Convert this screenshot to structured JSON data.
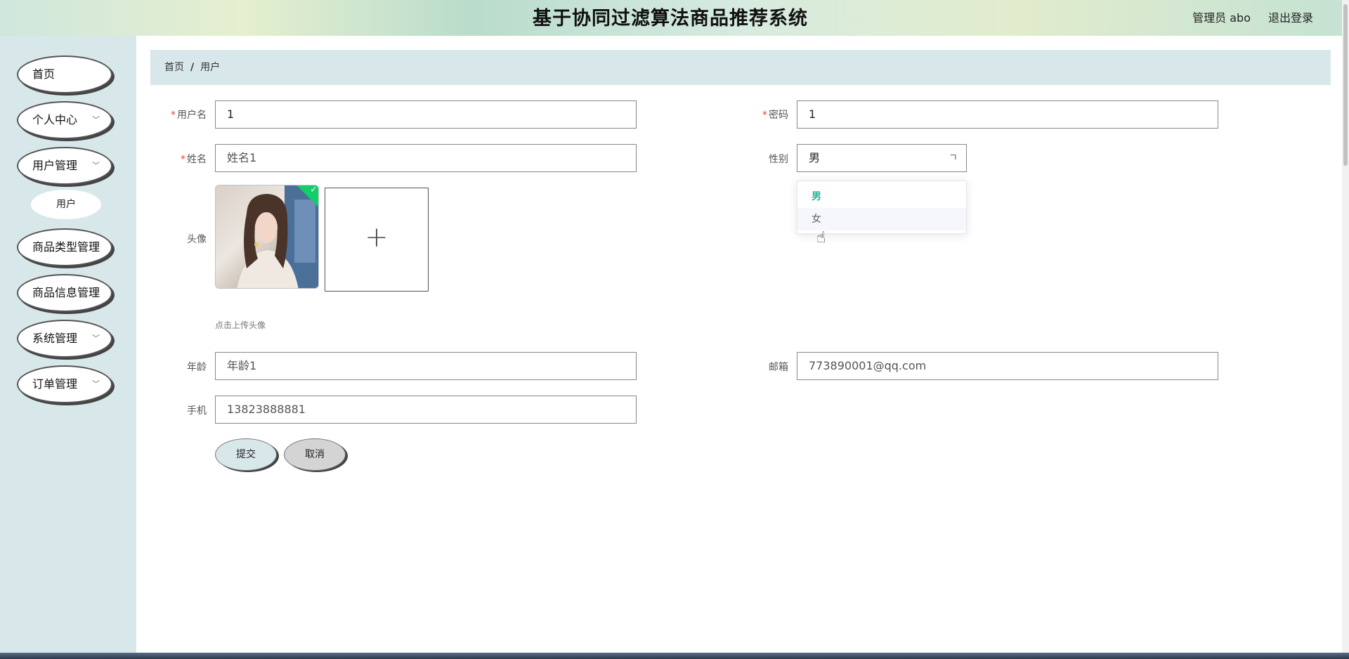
{
  "header": {
    "title": "基于协同过滤算法商品推荐系统",
    "user": "管理员 abo",
    "logout": "退出登录"
  },
  "sidebar": {
    "items": [
      {
        "label": "首页",
        "has_arrow": false
      },
      {
        "label": "个人中心",
        "has_arrow": true
      },
      {
        "label": "用户管理",
        "has_arrow": true
      },
      {
        "label": "商品类型管理",
        "has_arrow": false
      },
      {
        "label": "商品信息管理",
        "has_arrow": false
      },
      {
        "label": "系统管理",
        "has_arrow": true
      },
      {
        "label": "订单管理",
        "has_arrow": true
      }
    ],
    "subitem": "用户",
    "arrow": "﹀"
  },
  "breadcrumb": {
    "home": "首页",
    "separator": "/",
    "current": "用户"
  },
  "form": {
    "username": {
      "label": "用户名",
      "value": "1",
      "required": "*"
    },
    "password": {
      "label": "密码",
      "value": "1",
      "required": "*"
    },
    "name": {
      "label": "姓名",
      "value": "姓名1",
      "required": "*"
    },
    "gender": {
      "label": "性别",
      "value": "男",
      "arrow": "ㄱ"
    },
    "avatar": {
      "label": "头像",
      "hint": "点击上传头像",
      "plus": "+",
      "check": "✓"
    },
    "age": {
      "label": "年龄",
      "value": "年龄1"
    },
    "email": {
      "label": "邮箱",
      "value": "773890001@qq.com"
    },
    "phone": {
      "label": "手机",
      "value": "13823888881"
    }
  },
  "dropdown": {
    "options": [
      "男",
      "女"
    ],
    "selected": "男",
    "hovered": "女"
  },
  "buttons": {
    "submit": "提交",
    "cancel": "取消"
  },
  "cursor": "☝",
  "colors": {
    "sidebar_bg": "#d8e8ea",
    "accent_selected": "#1fb59a",
    "required": "#e64242",
    "upload_success": "#13ce66"
  }
}
